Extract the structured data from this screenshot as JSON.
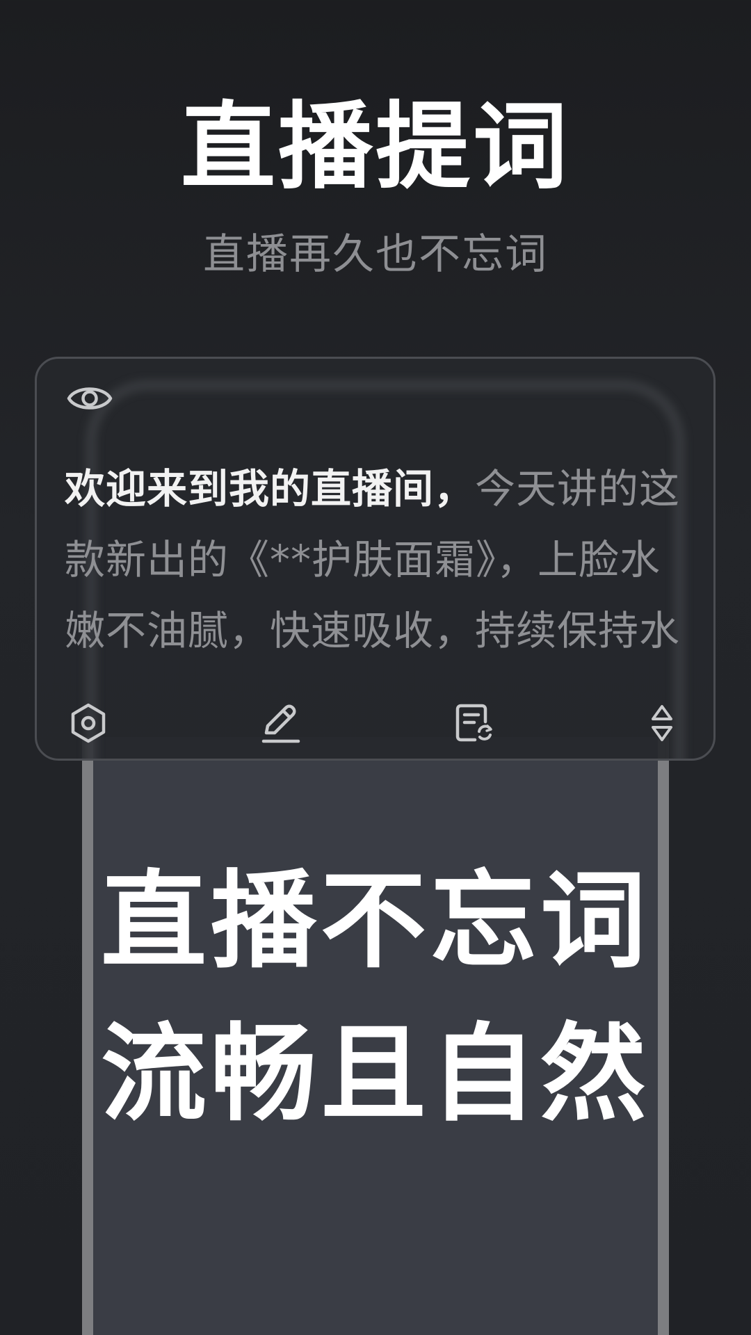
{
  "promo": {
    "headline": "直播提词",
    "subheadline": "直播再久也不忘词"
  },
  "prompter": {
    "visibility_icon": "eye-icon",
    "script_read": "欢迎来到我的直播间，",
    "script_unread": "今天讲的这款新出的《**护肤面霜》，上脸水嫩不油腻，快速吸收，持续保持水分",
    "toolbar": [
      {
        "name": "settings",
        "icon": "hexagon-settings-icon"
      },
      {
        "name": "edit",
        "icon": "pencil-icon"
      },
      {
        "name": "switch-script",
        "icon": "document-refresh-icon"
      },
      {
        "name": "scroll-control",
        "icon": "up-down-arrows-icon"
      }
    ]
  },
  "phone_screen": {
    "line1": "直播不忘词",
    "line2": "流畅且自然"
  },
  "colors": {
    "background": "#1f2124",
    "panel": "#26282c",
    "phone_screen": "#3a3d45",
    "text_primary": "#ffffff",
    "text_secondary": "#8e8f93"
  }
}
